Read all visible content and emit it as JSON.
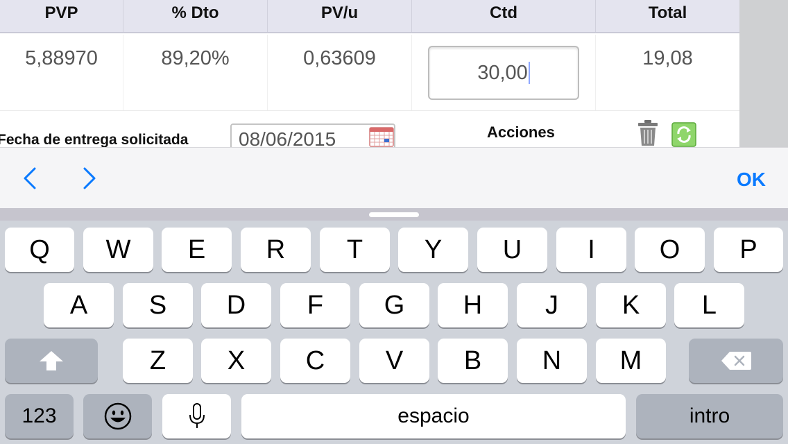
{
  "table": {
    "headers": [
      "PVP",
      "% Dto",
      "PV/u",
      "Ctd",
      "Total"
    ],
    "row": {
      "pvp": "5,88970",
      "dto": "89,20%",
      "pvu": "0,63609",
      "ctd": "30,00",
      "total": "19,08"
    }
  },
  "delivery": {
    "label": "Fecha de entrega solicitada",
    "date_value": "08/06/2015"
  },
  "actions": {
    "label": "Acciones"
  },
  "assistant_bar": {
    "ok_label": "OK"
  },
  "keyboard": {
    "row1": [
      "Q",
      "W",
      "E",
      "R",
      "T",
      "Y",
      "U",
      "I",
      "O",
      "P"
    ],
    "row2": [
      "A",
      "S",
      "D",
      "F",
      "G",
      "H",
      "J",
      "K",
      "L"
    ],
    "row3": [
      "Z",
      "X",
      "C",
      "V",
      "B",
      "N",
      "M"
    ],
    "numbers_label": "123",
    "space_label": "espacio",
    "return_label": "intro"
  },
  "colors": {
    "accent": "#0a7aff",
    "header_bg": "#e4e4ef",
    "keyboard_bg": "#cfd3da",
    "function_key_bg": "#adb3bd"
  }
}
